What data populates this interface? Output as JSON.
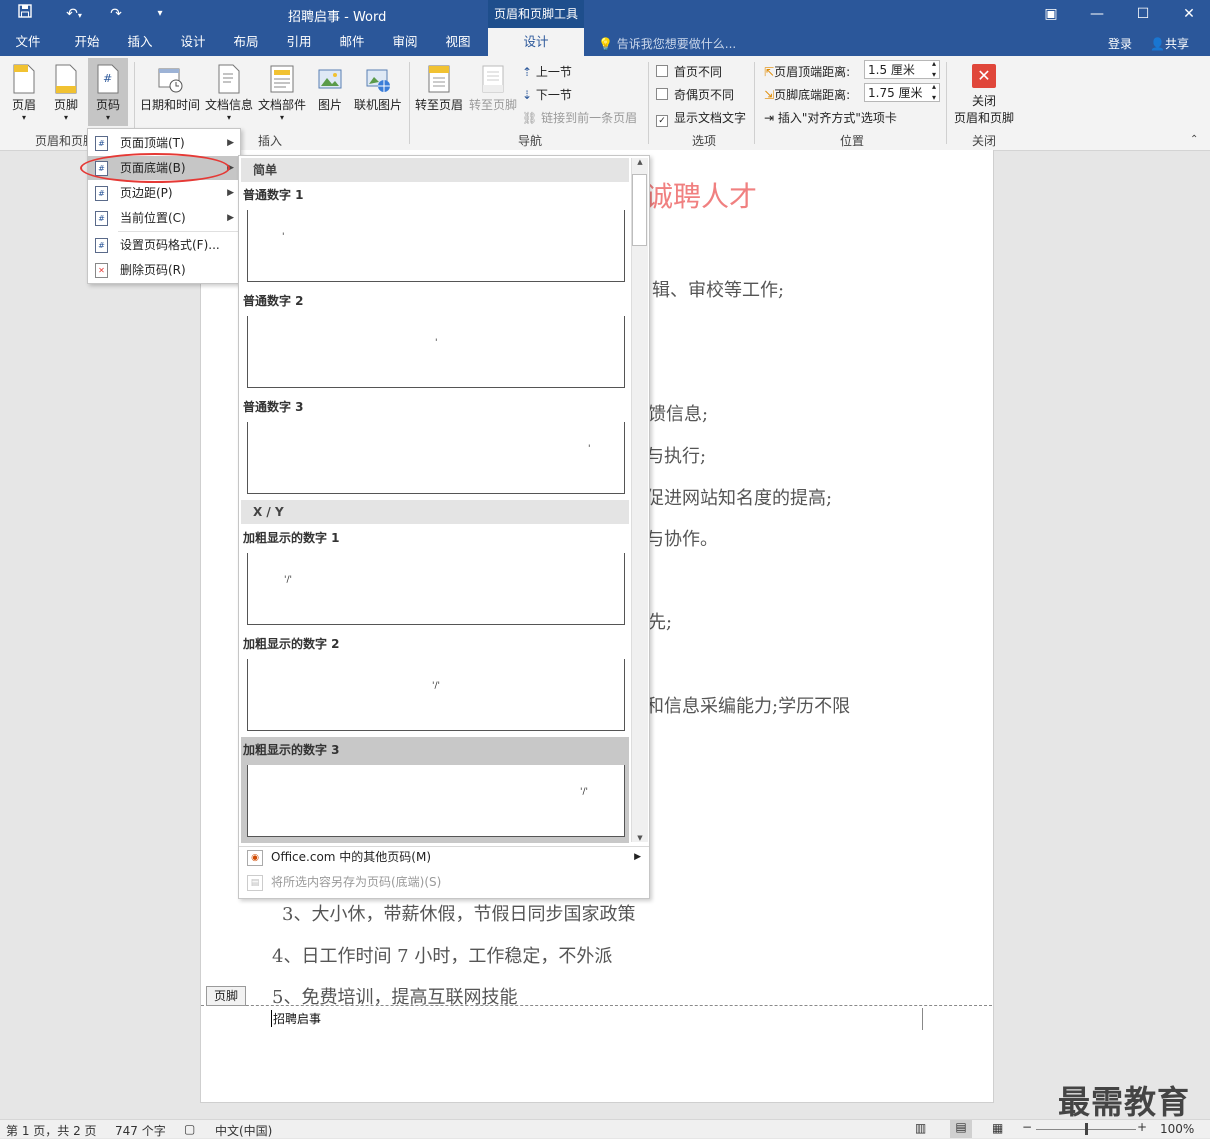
{
  "window": {
    "title": "招聘启事 - Word",
    "tool_context": "页眉和页脚工具",
    "quick_access": [
      "save-icon",
      "undo-icon",
      "redo-icon",
      "customize-icon"
    ]
  },
  "tabs": [
    "文件",
    "开始",
    "插入",
    "设计",
    "布局",
    "引用",
    "邮件",
    "审阅",
    "视图",
    "设计"
  ],
  "active_tab": "设计",
  "tell_me": "告诉我您想要做什么...",
  "login": "登录",
  "share": "共享",
  "ribbon": {
    "group1": {
      "buttons": [
        "页眉",
        "页脚",
        "页码"
      ],
      "label": "页眉和页脚"
    },
    "group2": {
      "buttons": [
        "日期和时间",
        "文档信息",
        "文档部件",
        "图片",
        "联机图片"
      ],
      "label": "插入"
    },
    "group3": {
      "buttons": [
        "转至页眉",
        "转至页脚"
      ],
      "small": [
        "上一节",
        "下一节",
        "链接到前一条页眉"
      ],
      "label": "导航"
    },
    "group4": {
      "options": [
        "首页不同",
        "奇偶页不同",
        "显示文档文字"
      ],
      "label": "选项"
    },
    "group5": {
      "header_dist_label": "页眉顶端距离:",
      "header_dist_value": "1.5 厘米",
      "footer_dist_label": "页脚底端距离:",
      "footer_dist_value": "1.75 厘米",
      "insert_align_tab": "插入\"对齐方式\"选项卡",
      "label": "位置"
    },
    "group6": {
      "button_line1": "关闭",
      "button_line2": "页眉和页脚",
      "label": "关闭"
    }
  },
  "page_number_menu": {
    "items": [
      "页面顶端(T)",
      "页面底端(B)",
      "页边距(P)",
      "当前位置(C)",
      "设置页码格式(F)...",
      "删除页码(R)"
    ]
  },
  "gallery": {
    "section1": "简单",
    "items1": [
      "普通数字 1",
      "普通数字 2",
      "普通数字 3"
    ],
    "section2": "X / Y",
    "items2": [
      "加粗显示的数字 1",
      "加粗显示的数字 2",
      "加粗显示的数字 3"
    ],
    "simple_mark": "'",
    "xy_mark": "'/'",
    "footer_items": [
      "Office.com 中的其他页码(M)",
      "将所选内容另存为页码(底端)(S)"
    ]
  },
  "document": {
    "heading_fragment": "诚聘人才",
    "lines": [
      "辑、审校等工作;",
      "馈信息;",
      "与执行;",
      "促进网站知名度的提高;",
      "与协作。",
      "先;",
      "和信息采编能力;学历不限",
      "3、大小休，带薪休假，节假日同步国家政策",
      "4、日工作时间 7 小时，工作稳定，不外派",
      "5、免费培训，提高互联网技能"
    ],
    "footer_tag": "页脚",
    "footer_text": "招聘启事"
  },
  "status": {
    "page": "第 1 页，共 2 页",
    "words": "747 个字",
    "language": "中文(中国)",
    "zoom": "100%",
    "zoom_level_pct": 100
  },
  "watermark": "最需教育"
}
